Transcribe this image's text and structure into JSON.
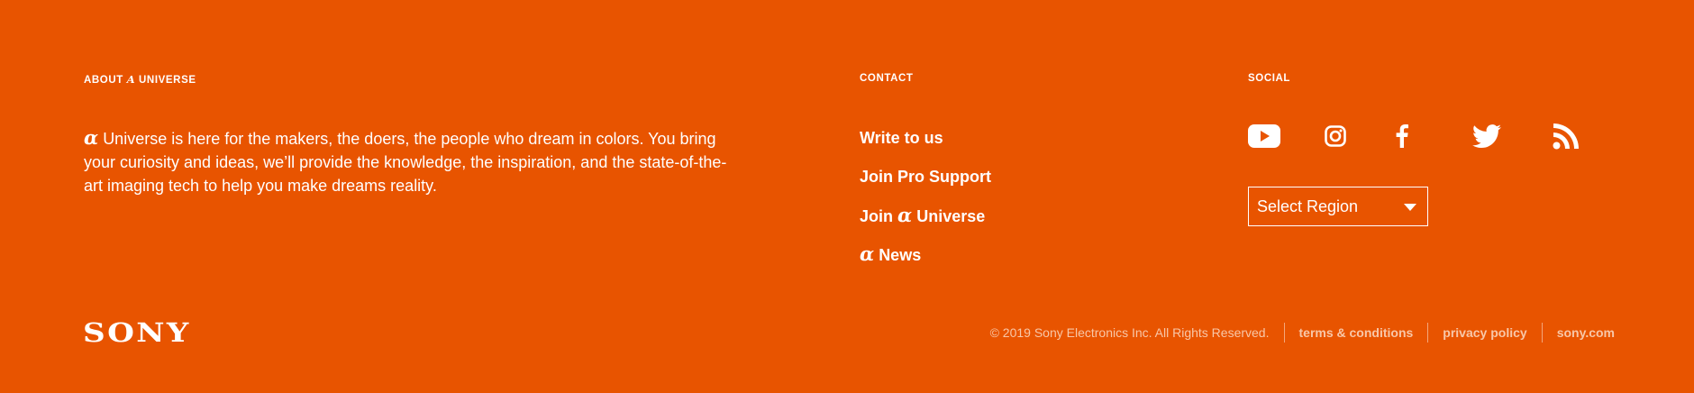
{
  "about": {
    "title_prefix": "ABOUT",
    "title_alpha": "α",
    "title_suffix": "UNIVERSE",
    "text_alpha": "α",
    "text": "Universe is here for the makers, the doers, the people who dream in colors. You bring your curiosity and ideas, we’ll provide the knowledge, the inspiration, and the state-of-the-art imaging tech to help you make dreams reality."
  },
  "contact": {
    "title": "CONTACT",
    "links": [
      {
        "label": "Write to us"
      },
      {
        "label": "Join Pro Support"
      },
      {
        "prefix": "Join",
        "alpha": "α",
        "suffix": "Universe"
      },
      {
        "alpha": "α",
        "suffix": "News"
      }
    ]
  },
  "social": {
    "title": "SOCIAL",
    "icons": [
      "youtube-icon",
      "instagram-icon",
      "facebook-icon",
      "twitter-icon",
      "rss-icon"
    ]
  },
  "region": {
    "selected": "Select Region"
  },
  "brand": {
    "logo": "SONY"
  },
  "footer": {
    "copyright": "© 2019 Sony Electronics Inc. All Rights Reserved.",
    "terms": "terms & conditions",
    "privacy": "privacy policy",
    "site": "sony.com"
  },
  "colors": {
    "background": "#e85400",
    "text": "#ffffff",
    "muted": "#f8c7a8"
  }
}
